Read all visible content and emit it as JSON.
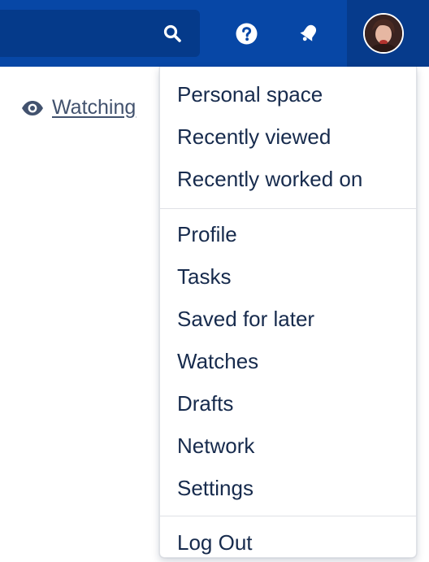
{
  "header": {
    "colors": {
      "bar": "#0747a6",
      "search_box": "#053a8a",
      "avatar_area": "#063b8c"
    },
    "icons": [
      "search-icon",
      "help-icon",
      "notification-icon",
      "user-avatar"
    ]
  },
  "page": {
    "watching_label": "Watching",
    "watching_icon": "eye-icon"
  },
  "user_menu": {
    "sections": [
      {
        "items": [
          "Personal space",
          "Recently viewed",
          "Recently worked on"
        ]
      },
      {
        "items": [
          "Profile",
          "Tasks",
          "Saved for later",
          "Watches",
          "Drafts",
          "Network",
          "Settings"
        ]
      },
      {
        "items": [
          "Log Out"
        ]
      }
    ]
  }
}
